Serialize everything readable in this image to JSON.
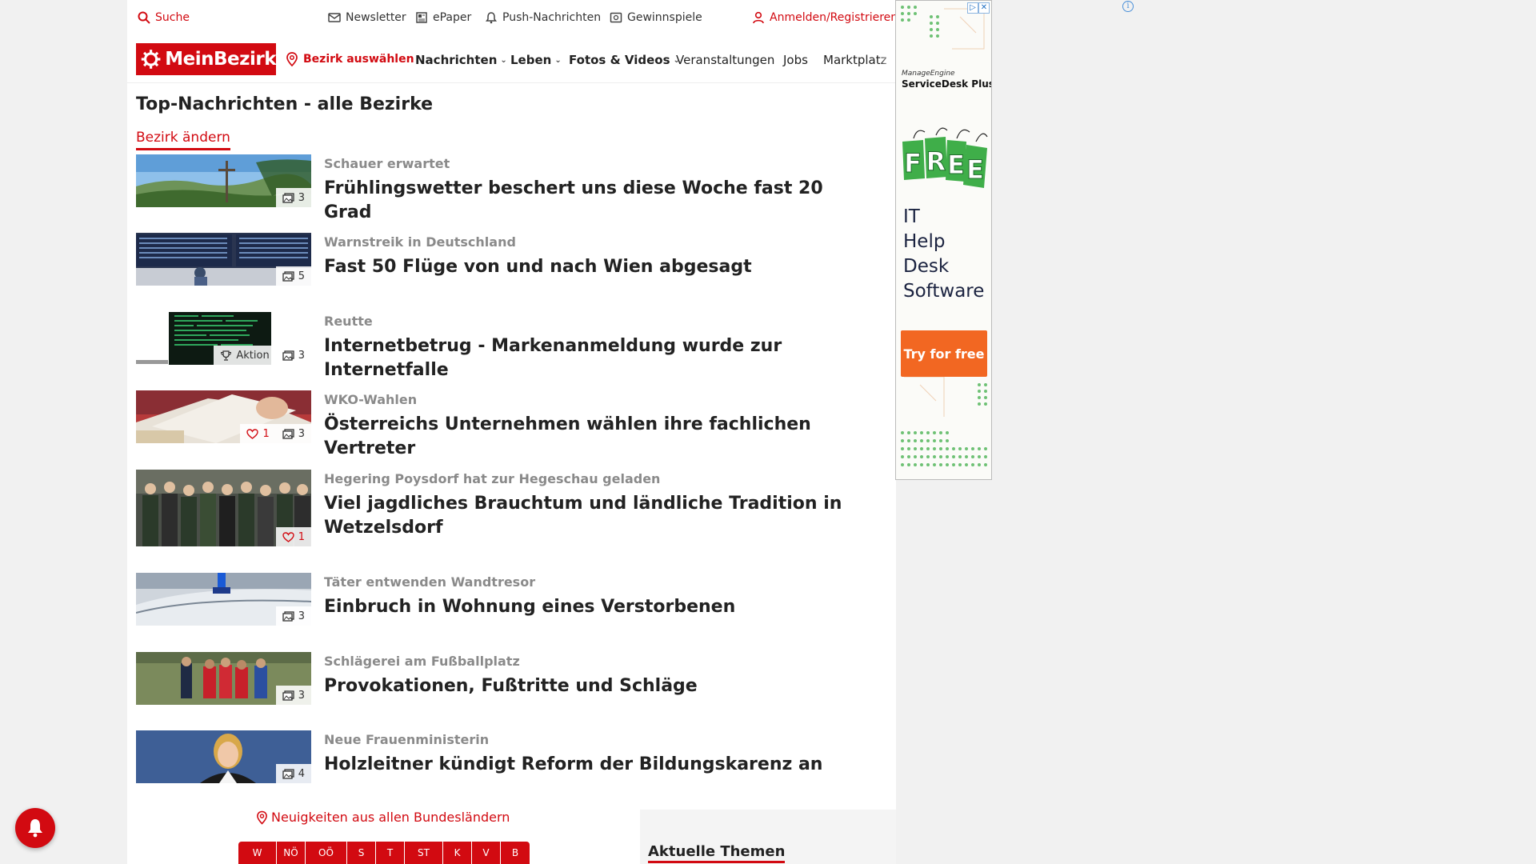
{
  "topbar": {
    "search": "Suche",
    "newsletter": "Newsletter",
    "epaper": "ePaper",
    "push": "Push-Nachrichten",
    "games": "Gewinnspiele",
    "login": "Anmelden/Registrieren"
  },
  "nav": {
    "logo": "MeinBezirk",
    "bezirk": "Bezirk auswählen",
    "items": [
      {
        "label": "Nachrichten",
        "dropdown": true
      },
      {
        "label": "Leben",
        "dropdown": true
      },
      {
        "label": "Fotos & Videos",
        "dropdown": true
      },
      {
        "label": "Veranstaltungen",
        "dropdown": false
      },
      {
        "label": "Jobs",
        "dropdown": false
      },
      {
        "label": "Marktplatz",
        "dropdown": false
      }
    ]
  },
  "main": {
    "title": "Top-Nachrichten - alle Bezirke",
    "change_link": "Bezirk ändern",
    "articles": [
      {
        "kicker": "Schauer erwartet",
        "headline": "Frühlingswetter beschert uns diese Woche fast 20 Grad",
        "photos": "3",
        "likes": "",
        "aktion": ""
      },
      {
        "kicker": "Warnstreik in Deutschland",
        "headline": "Fast 50 Flüge von und nach Wien abgesagt",
        "photos": "5",
        "likes": "",
        "aktion": ""
      },
      {
        "kicker": "Reutte",
        "headline": "Internetbetrug - Markenanmeldung wurde zur Internetfalle",
        "photos": "3",
        "likes": "",
        "aktion": "Aktion"
      },
      {
        "kicker": "WKO-Wahlen",
        "headline": "Österreichs Unternehmen wählen ihre fachlichen Vertreter",
        "photos": "3",
        "likes": "1",
        "aktion": ""
      },
      {
        "kicker": "Hegering Poysdorf hat zur Hegeschau geladen",
        "headline": "Viel jagdliches Brauchtum und ländliche Tradition in Wetzelsdorf",
        "photos": "",
        "likes": "1",
        "aktion": ""
      },
      {
        "kicker": "Täter entwenden Wandtresor",
        "headline": "Einbruch in Wohnung eines Verstorbenen",
        "photos": "3",
        "likes": "",
        "aktion": ""
      },
      {
        "kicker": "Schlägerei am Fußballplatz",
        "headline": "Provokationen, Fußtritte und Schläge",
        "photos": "3",
        "likes": "",
        "aktion": ""
      },
      {
        "kicker": "Neue Frauenministerin",
        "headline": "Holzleitner kündigt Reform der Bildungskarenz an",
        "photos": "4",
        "likes": "",
        "aktion": ""
      }
    ]
  },
  "footer": {
    "states_link": "Neuigkeiten aus allen Bundesländern",
    "states": [
      "W",
      "NÖ",
      "OÖ",
      "S",
      "T",
      "ST",
      "K",
      "V",
      "B"
    ],
    "themes_title": "Aktuelle Themen"
  },
  "ad": {
    "brand_line1": "ManageEngine",
    "brand_line2": "ServiceDesk Plus",
    "free": "FREE",
    "copy_lines": [
      "IT",
      "Help",
      "Desk",
      "Software"
    ],
    "cta": "Try for free",
    "colors": {
      "cta": "#f26722",
      "accent_green": "#3fae49"
    }
  },
  "colors": {
    "brand_red": "#d20a11",
    "kicker_gray": "#8a8a8a",
    "text": "#222222"
  }
}
